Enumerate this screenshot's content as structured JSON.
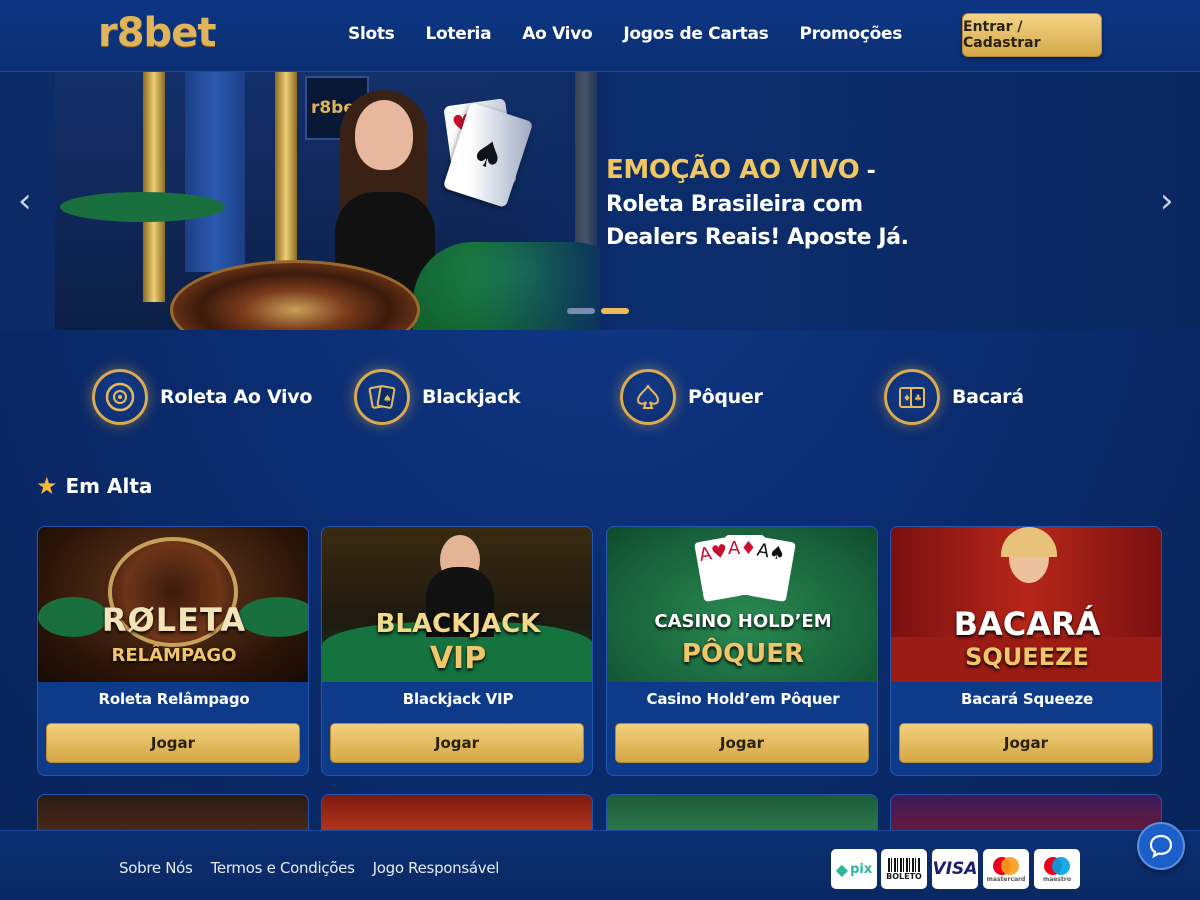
{
  "header": {
    "logo": "r8bet",
    "nav": [
      "Slots",
      "Loteria",
      "Ao Vivo",
      "Jogos de Cartas",
      "Promoções"
    ],
    "cta_label": "Entrar / Cadastrar"
  },
  "hero": {
    "screen_logo": "r8bet",
    "highlight": "EMOÇÃO AO VIVO",
    "text": " - Roleta Brasileira com Dealers Reais! Aposte Já.",
    "prev_arrow": "‹",
    "next_arrow": "›",
    "slide_count": 2,
    "active_slide": 2
  },
  "categories": [
    {
      "label": "Roleta Ao Vivo",
      "icon": "roulette-icon",
      "glyph": "✺"
    },
    {
      "label": "Blackjack",
      "icon": "cards-icon",
      "glyph": "🂡"
    },
    {
      "label": "Pôquer",
      "icon": "spade-icon",
      "glyph": "♠"
    },
    {
      "label": "Bacará",
      "icon": "cards-icon",
      "glyph": "♦"
    }
  ],
  "section": {
    "title": "Em Alta",
    "icon": "star-icon"
  },
  "games": [
    {
      "title": "Roleta Relâmpago",
      "art_line1": "RØLETA",
      "art_line2": "RELÂMPAGO",
      "play": "Jogar"
    },
    {
      "title": "Blackjack VIP",
      "art_line1": "BLACKJACK",
      "art_line2": "VIP",
      "play": "Jogar"
    },
    {
      "title": "Casino Hold’em Pôquer",
      "art_line1": "CASINO HOLD’EM",
      "art_line2": "PÔQUER",
      "play": "Jogar"
    },
    {
      "title": "Bacará Squeeze",
      "art_line1": "BACARÁ",
      "art_line2": "SQUEEZE",
      "play": "Jogar"
    }
  ],
  "footer": {
    "links": [
      "Sobre Nós",
      "Termos e Condições",
      "Jogo Responsável"
    ],
    "payments": [
      {
        "name": "pix",
        "label": "pix"
      },
      {
        "name": "boleto",
        "label": "BOLETO"
      },
      {
        "name": "visa",
        "label": "VISA"
      },
      {
        "name": "mastercard",
        "label": "mastercard"
      },
      {
        "name": "maestro",
        "label": "maestro"
      }
    ]
  },
  "colors": {
    "accent_gold": "#e0b45a",
    "background": "#0a2a6b",
    "card_bg": "#0e3a8a"
  }
}
